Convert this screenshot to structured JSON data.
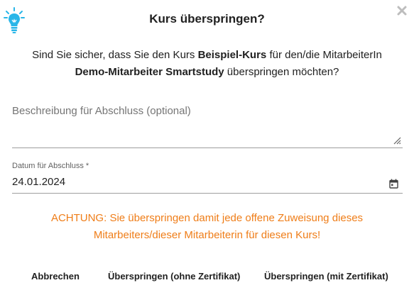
{
  "dialog": {
    "title": "Kurs überspringen?",
    "message": {
      "part1": "Sind Sie sicher, dass Sie den Kurs ",
      "course": "Beispiel-Kurs",
      "part2": " für den/die MitarbeiterIn ",
      "employee": "Demo-Mitarbeiter Smartstudy",
      "part3": " überspringen möchten?"
    },
    "description_field": {
      "placeholder": "Beschreibung für Abschluss (optional)",
      "value": ""
    },
    "date_field": {
      "label": "Datum für Abschluss *",
      "value": "24.01.2024"
    },
    "warning": "ACHTUNG: Sie überspringen damit jede offene Zuweisung dieses Mitarbeiters/dieser Mitarbeiterin für diesen Kurs!",
    "buttons": {
      "cancel": "Abbrechen",
      "skip_without_certificate": "Überspringen (ohne Zertifikat)",
      "skip_with_certificate": "Überspringen (mit Zertifikat)"
    }
  },
  "colors": {
    "accent_icon": "#29b6e8",
    "warning": "#ef7d18",
    "text": "#212121",
    "muted": "#757575"
  },
  "icons": [
    "lightbulb-icon",
    "close-icon",
    "resize-handle-icon",
    "calendar-icon"
  ]
}
